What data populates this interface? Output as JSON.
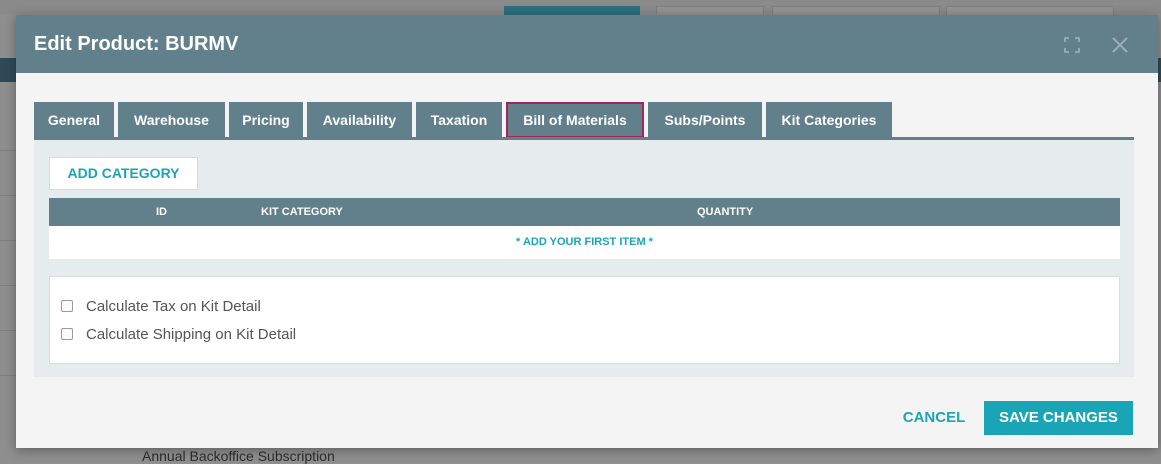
{
  "modal": {
    "title": "Edit Product: BURMV"
  },
  "tabs": [
    {
      "label": "General"
    },
    {
      "label": "Warehouse"
    },
    {
      "label": "Pricing"
    },
    {
      "label": "Availability"
    },
    {
      "label": "Taxation"
    },
    {
      "label": "Bill of Materials",
      "active": true
    },
    {
      "label": "Subs/Points"
    },
    {
      "label": "Kit Categories"
    }
  ],
  "bom": {
    "add_category_label": "ADD CATEGORY",
    "columns": [
      "ID",
      "KIT CATEGORY",
      "QUANTITY"
    ],
    "empty_message": "* ADD YOUR FIRST ITEM *",
    "options": [
      {
        "label": "Calculate Tax on Kit Detail",
        "checked": false
      },
      {
        "label": "Calculate Shipping on Kit Detail",
        "checked": false
      }
    ]
  },
  "footer": {
    "cancel_label": "CANCEL",
    "save_label": "SAVE CHANGES"
  },
  "background": {
    "visible_text": "Annual Backoffice Subscription"
  },
  "colors": {
    "header": "#62808c",
    "accent": "#1aa5b6",
    "active_tab_border": "#a4245c"
  },
  "icons": {
    "expand": "expand-icon",
    "close": "close-icon"
  }
}
